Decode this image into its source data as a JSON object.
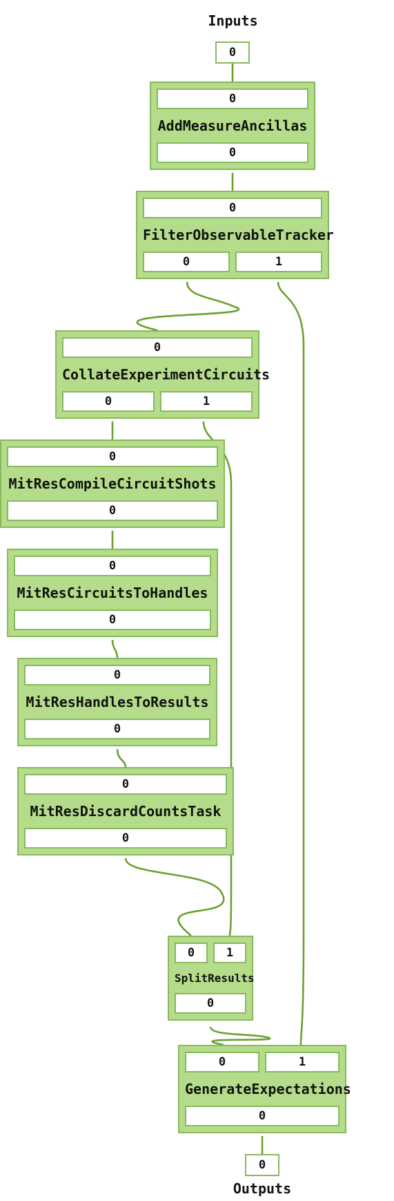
{
  "io": {
    "inputs_label": "Inputs",
    "outputs_label": "Outputs",
    "input_port": "0",
    "output_port": "0"
  },
  "nodes": {
    "n1": {
      "title": "AddMeasureAncillas",
      "in": [
        "0"
      ],
      "out": [
        "0"
      ]
    },
    "n2": {
      "title": "FilterObservableTracker",
      "in": [
        "0"
      ],
      "out": [
        "0",
        "1"
      ]
    },
    "n3": {
      "title": "CollateExperimentCircuits",
      "in": [
        "0"
      ],
      "out": [
        "0",
        "1"
      ]
    },
    "n4": {
      "title": "MitResCompileCircuitShots",
      "in": [
        "0"
      ],
      "out": [
        "0"
      ]
    },
    "n5": {
      "title": "MitResCircuitsToHandles",
      "in": [
        "0"
      ],
      "out": [
        "0"
      ]
    },
    "n6": {
      "title": "MitResHandlesToResults",
      "in": [
        "0"
      ],
      "out": [
        "0"
      ]
    },
    "n7": {
      "title": "MitResDiscardCountsTask",
      "in": [
        "0"
      ],
      "out": [
        "0"
      ]
    },
    "n8": {
      "title": "SplitResults",
      "in": [
        "0",
        "1"
      ],
      "out": [
        "0"
      ]
    },
    "n9": {
      "title": "GenerateExpectations",
      "in": [
        "0",
        "1"
      ],
      "out": [
        "0"
      ]
    }
  },
  "chart_data": {
    "type": "diagram",
    "title": "Task graph",
    "sources": [
      "Inputs"
    ],
    "sinks": [
      "Outputs"
    ],
    "nodes": [
      {
        "id": "Inputs",
        "kind": "source",
        "outputs": [
          "0"
        ]
      },
      {
        "id": "AddMeasureAncillas",
        "inputs": [
          "0"
        ],
        "outputs": [
          "0"
        ]
      },
      {
        "id": "FilterObservableTracker",
        "inputs": [
          "0"
        ],
        "outputs": [
          "0",
          "1"
        ]
      },
      {
        "id": "CollateExperimentCircuits",
        "inputs": [
          "0"
        ],
        "outputs": [
          "0",
          "1"
        ]
      },
      {
        "id": "MitResCompileCircuitShots",
        "inputs": [
          "0"
        ],
        "outputs": [
          "0"
        ]
      },
      {
        "id": "MitResCircuitsToHandles",
        "inputs": [
          "0"
        ],
        "outputs": [
          "0"
        ]
      },
      {
        "id": "MitResHandlesToResults",
        "inputs": [
          "0"
        ],
        "outputs": [
          "0"
        ]
      },
      {
        "id": "MitResDiscardCountsTask",
        "inputs": [
          "0"
        ],
        "outputs": [
          "0"
        ]
      },
      {
        "id": "SplitResults",
        "inputs": [
          "0",
          "1"
        ],
        "outputs": [
          "0"
        ]
      },
      {
        "id": "GenerateExpectations",
        "inputs": [
          "0",
          "1"
        ],
        "outputs": [
          "0"
        ]
      },
      {
        "id": "Outputs",
        "kind": "sink",
        "inputs": [
          "0"
        ]
      }
    ],
    "edges": [
      {
        "from": "Inputs.0",
        "to": "AddMeasureAncillas.0"
      },
      {
        "from": "AddMeasureAncillas.0",
        "to": "FilterObservableTracker.0"
      },
      {
        "from": "FilterObservableTracker.0",
        "to": "CollateExperimentCircuits.0"
      },
      {
        "from": "FilterObservableTracker.1",
        "to": "GenerateExpectations.1"
      },
      {
        "from": "CollateExperimentCircuits.0",
        "to": "MitResCompileCircuitShots.0"
      },
      {
        "from": "CollateExperimentCircuits.1",
        "to": "SplitResults.1"
      },
      {
        "from": "MitResCompileCircuitShots.0",
        "to": "MitResCircuitsToHandles.0"
      },
      {
        "from": "MitResCircuitsToHandles.0",
        "to": "MitResHandlesToResults.0"
      },
      {
        "from": "MitResHandlesToResults.0",
        "to": "MitResDiscardCountsTask.0"
      },
      {
        "from": "MitResDiscardCountsTask.0",
        "to": "SplitResults.0"
      },
      {
        "from": "SplitResults.0",
        "to": "GenerateExpectations.0"
      },
      {
        "from": "GenerateExpectations.0",
        "to": "Outputs.0"
      }
    ]
  }
}
